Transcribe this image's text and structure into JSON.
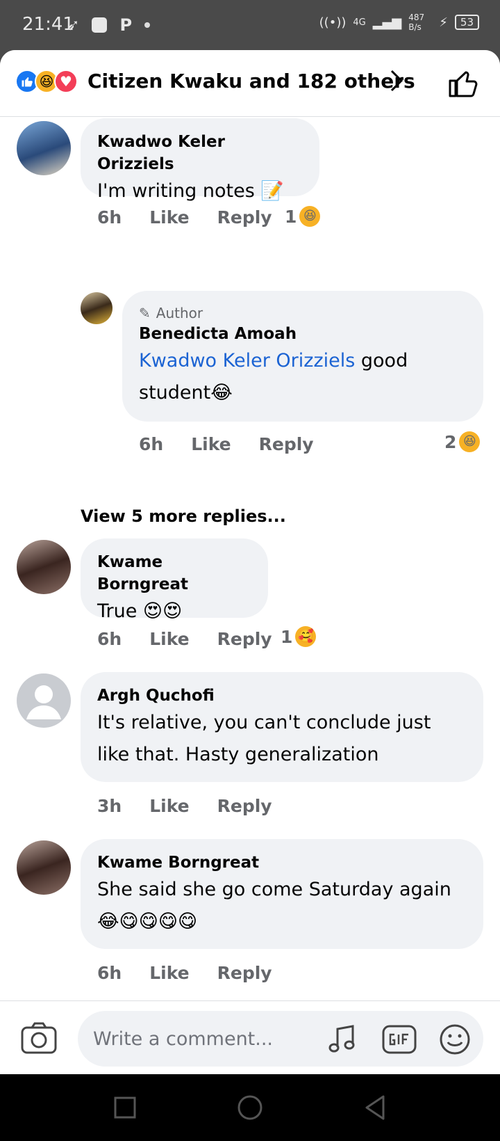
{
  "status_bar": {
    "time": "21:41",
    "network": "4G",
    "speed": "487 B/s",
    "battery": "53"
  },
  "header": {
    "reaction_summary": "Citizen Kwaku and 182 others",
    "reaction_icons": [
      "like-icon",
      "haha-icon",
      "love-icon"
    ]
  },
  "comments": [
    {
      "name": "Kwadwo Keler Orizziels",
      "text": "I'm writing notes 📝",
      "time": "6h",
      "like_label": "Like",
      "reply_label": "Reply",
      "reaction_count": "1",
      "reaction_emoji": "😆"
    },
    {
      "author_tag": "Author",
      "name": "Benedicta Amoah",
      "mention": "Kwadwo Keler Orizziels",
      "text": " good student😂",
      "time": "6h",
      "like_label": "Like",
      "reply_label": "Reply",
      "reaction_count": "2",
      "reaction_emoji": "😆"
    },
    {
      "name": "Kwame Borngreat",
      "text": "True 😍😍",
      "time": "6h",
      "like_label": "Like",
      "reply_label": "Reply",
      "reaction_count": "1",
      "reaction_emoji": "🥰"
    },
    {
      "name": "Argh Quchofi",
      "text": "It's relative, you can't conclude just like that. Hasty generalization",
      "time": "3h",
      "like_label": "Like",
      "reply_label": "Reply"
    },
    {
      "name": "Kwame Borngreat",
      "text": "She said she go come Saturday again 😂😋😋😋😋",
      "time": "6h",
      "like_label": "Like",
      "reply_label": "Reply"
    }
  ],
  "view_more": "View 5 more replies...",
  "compose": {
    "placeholder": "Write a comment..."
  },
  "colors": {
    "accent": "#1877f2",
    "mention": "#1b63d3",
    "bubble": "#f0f2f5",
    "meta": "#65676b"
  }
}
